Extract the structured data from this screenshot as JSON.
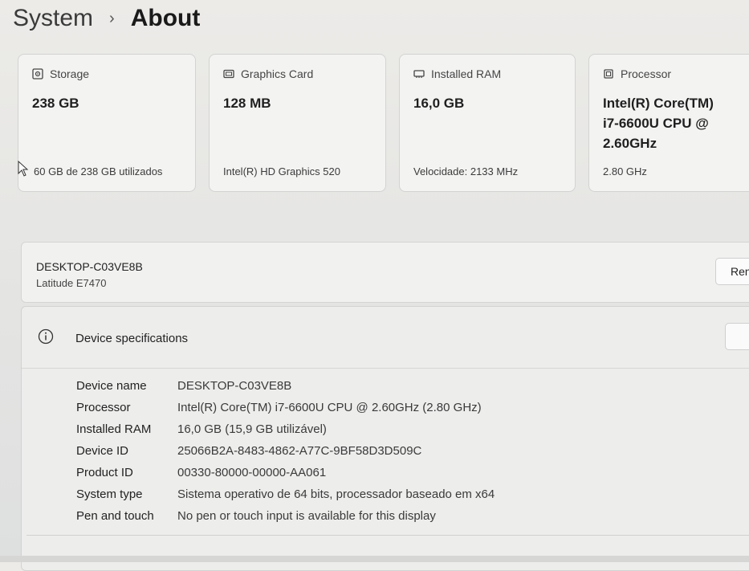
{
  "breadcrumb": {
    "parent": "System",
    "separator": "›",
    "current": "About"
  },
  "cards": [
    {
      "icon": "storage-icon",
      "label": "Storage",
      "value": "238 GB",
      "sub": "60 GB de 238 GB utilizados"
    },
    {
      "icon": "graphics-card-icon",
      "label": "Graphics Card",
      "value": "128 MB",
      "sub": "Intel(R) HD Graphics 520"
    },
    {
      "icon": "ram-icon",
      "label": "Installed RAM",
      "value": "16,0 GB",
      "sub": "Velocidade: 2133 MHz"
    },
    {
      "icon": "processor-icon",
      "label": "Processor",
      "value_lines": [
        "Intel(R) Core(TM)",
        "i7-6600U CPU @",
        "2.60GHz"
      ],
      "sub": "2.80 GHz"
    }
  ],
  "device": {
    "name": "DESKTOP-C03VE8B",
    "model": "Latitude E7470",
    "rename_label": "Ren"
  },
  "specs": {
    "title": "Device specifications",
    "rows": [
      {
        "key": "Device name",
        "value": "DESKTOP-C03VE8B"
      },
      {
        "key": "Processor",
        "value": "Intel(R) Core(TM) i7-6600U CPU @ 2.60GHz (2.80 GHz)"
      },
      {
        "key": "Installed RAM",
        "value": "16,0 GB (15,9 GB utilizável)"
      },
      {
        "key": "Device ID",
        "value": "25066B2A-8483-4862-A77C-9BF58D3D509C"
      },
      {
        "key": "Product ID",
        "value": "00330-80000-00000-AA061"
      },
      {
        "key": "System type",
        "value": "Sistema operativo de 64 bits, processador baseado em x64"
      },
      {
        "key": "Pen and touch",
        "value": "No pen or touch input is available for this display"
      }
    ]
  }
}
